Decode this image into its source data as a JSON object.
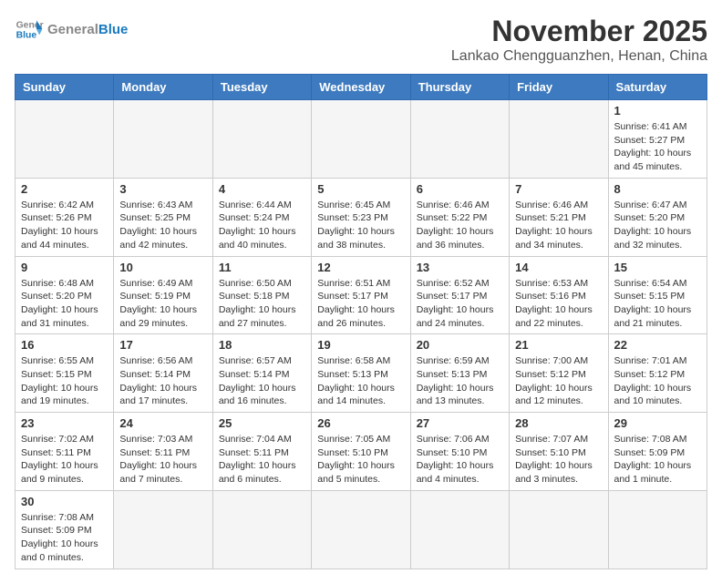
{
  "header": {
    "logo_general": "General",
    "logo_blue": "Blue",
    "month_title": "November 2025",
    "location": "Lankao Chengguanzhen, Henan, China"
  },
  "weekdays": [
    "Sunday",
    "Monday",
    "Tuesday",
    "Wednesday",
    "Thursday",
    "Friday",
    "Saturday"
  ],
  "weeks": [
    [
      {
        "day": "",
        "info": ""
      },
      {
        "day": "",
        "info": ""
      },
      {
        "day": "",
        "info": ""
      },
      {
        "day": "",
        "info": ""
      },
      {
        "day": "",
        "info": ""
      },
      {
        "day": "",
        "info": ""
      },
      {
        "day": "1",
        "info": "Sunrise: 6:41 AM\nSunset: 5:27 PM\nDaylight: 10 hours and 45 minutes."
      }
    ],
    [
      {
        "day": "2",
        "info": "Sunrise: 6:42 AM\nSunset: 5:26 PM\nDaylight: 10 hours and 44 minutes."
      },
      {
        "day": "3",
        "info": "Sunrise: 6:43 AM\nSunset: 5:25 PM\nDaylight: 10 hours and 42 minutes."
      },
      {
        "day": "4",
        "info": "Sunrise: 6:44 AM\nSunset: 5:24 PM\nDaylight: 10 hours and 40 minutes."
      },
      {
        "day": "5",
        "info": "Sunrise: 6:45 AM\nSunset: 5:23 PM\nDaylight: 10 hours and 38 minutes."
      },
      {
        "day": "6",
        "info": "Sunrise: 6:46 AM\nSunset: 5:22 PM\nDaylight: 10 hours and 36 minutes."
      },
      {
        "day": "7",
        "info": "Sunrise: 6:46 AM\nSunset: 5:21 PM\nDaylight: 10 hours and 34 minutes."
      },
      {
        "day": "8",
        "info": "Sunrise: 6:47 AM\nSunset: 5:20 PM\nDaylight: 10 hours and 32 minutes."
      }
    ],
    [
      {
        "day": "9",
        "info": "Sunrise: 6:48 AM\nSunset: 5:20 PM\nDaylight: 10 hours and 31 minutes."
      },
      {
        "day": "10",
        "info": "Sunrise: 6:49 AM\nSunset: 5:19 PM\nDaylight: 10 hours and 29 minutes."
      },
      {
        "day": "11",
        "info": "Sunrise: 6:50 AM\nSunset: 5:18 PM\nDaylight: 10 hours and 27 minutes."
      },
      {
        "day": "12",
        "info": "Sunrise: 6:51 AM\nSunset: 5:17 PM\nDaylight: 10 hours and 26 minutes."
      },
      {
        "day": "13",
        "info": "Sunrise: 6:52 AM\nSunset: 5:17 PM\nDaylight: 10 hours and 24 minutes."
      },
      {
        "day": "14",
        "info": "Sunrise: 6:53 AM\nSunset: 5:16 PM\nDaylight: 10 hours and 22 minutes."
      },
      {
        "day": "15",
        "info": "Sunrise: 6:54 AM\nSunset: 5:15 PM\nDaylight: 10 hours and 21 minutes."
      }
    ],
    [
      {
        "day": "16",
        "info": "Sunrise: 6:55 AM\nSunset: 5:15 PM\nDaylight: 10 hours and 19 minutes."
      },
      {
        "day": "17",
        "info": "Sunrise: 6:56 AM\nSunset: 5:14 PM\nDaylight: 10 hours and 17 minutes."
      },
      {
        "day": "18",
        "info": "Sunrise: 6:57 AM\nSunset: 5:14 PM\nDaylight: 10 hours and 16 minutes."
      },
      {
        "day": "19",
        "info": "Sunrise: 6:58 AM\nSunset: 5:13 PM\nDaylight: 10 hours and 14 minutes."
      },
      {
        "day": "20",
        "info": "Sunrise: 6:59 AM\nSunset: 5:13 PM\nDaylight: 10 hours and 13 minutes."
      },
      {
        "day": "21",
        "info": "Sunrise: 7:00 AM\nSunset: 5:12 PM\nDaylight: 10 hours and 12 minutes."
      },
      {
        "day": "22",
        "info": "Sunrise: 7:01 AM\nSunset: 5:12 PM\nDaylight: 10 hours and 10 minutes."
      }
    ],
    [
      {
        "day": "23",
        "info": "Sunrise: 7:02 AM\nSunset: 5:11 PM\nDaylight: 10 hours and 9 minutes."
      },
      {
        "day": "24",
        "info": "Sunrise: 7:03 AM\nSunset: 5:11 PM\nDaylight: 10 hours and 7 minutes."
      },
      {
        "day": "25",
        "info": "Sunrise: 7:04 AM\nSunset: 5:11 PM\nDaylight: 10 hours and 6 minutes."
      },
      {
        "day": "26",
        "info": "Sunrise: 7:05 AM\nSunset: 5:10 PM\nDaylight: 10 hours and 5 minutes."
      },
      {
        "day": "27",
        "info": "Sunrise: 7:06 AM\nSunset: 5:10 PM\nDaylight: 10 hours and 4 minutes."
      },
      {
        "day": "28",
        "info": "Sunrise: 7:07 AM\nSunset: 5:10 PM\nDaylight: 10 hours and 3 minutes."
      },
      {
        "day": "29",
        "info": "Sunrise: 7:08 AM\nSunset: 5:09 PM\nDaylight: 10 hours and 1 minute."
      }
    ],
    [
      {
        "day": "30",
        "info": "Sunrise: 7:08 AM\nSunset: 5:09 PM\nDaylight: 10 hours and 0 minutes."
      },
      {
        "day": "",
        "info": ""
      },
      {
        "day": "",
        "info": ""
      },
      {
        "day": "",
        "info": ""
      },
      {
        "day": "",
        "info": ""
      },
      {
        "day": "",
        "info": ""
      },
      {
        "day": "",
        "info": ""
      }
    ]
  ]
}
